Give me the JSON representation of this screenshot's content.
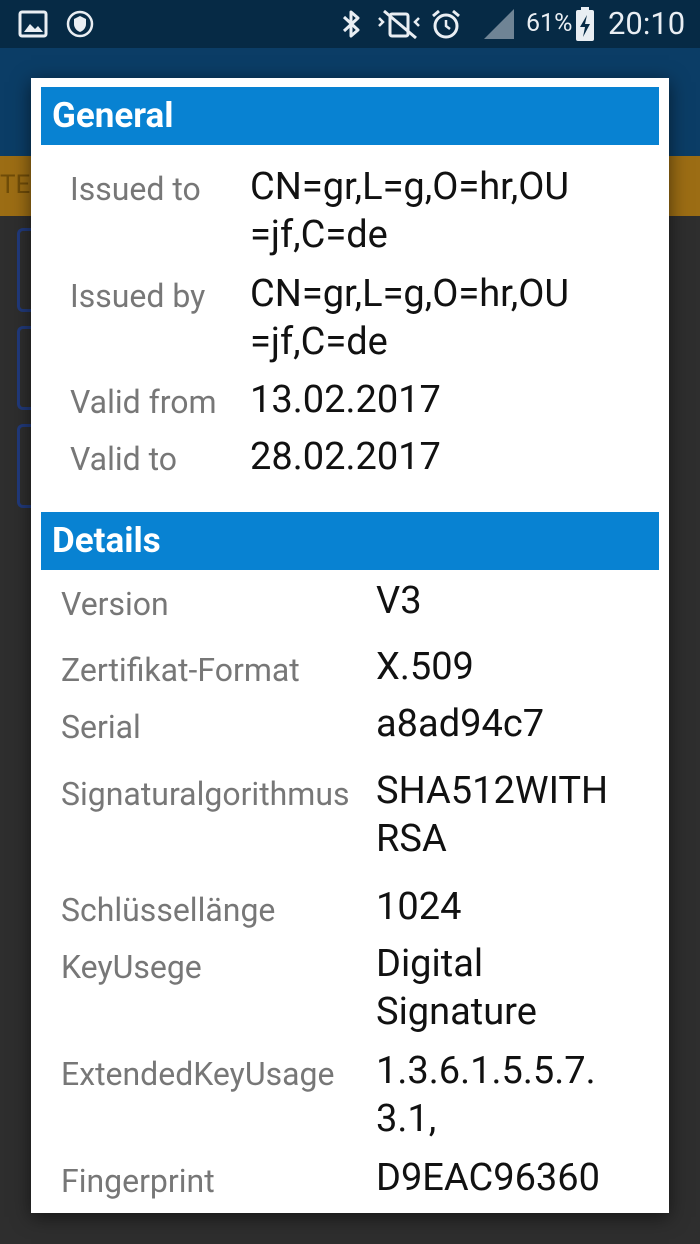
{
  "status_bar": {
    "battery_percent": "61%",
    "time": "20:10"
  },
  "background": {
    "strip_text": "TE"
  },
  "dialog": {
    "general": {
      "title": "General",
      "rows": [
        {
          "label": "Issued to",
          "value": "CN=gr,L=g,O=hr,OU\n=jf,C=de"
        },
        {
          "label": "Issued by",
          "value": "CN=gr,L=g,O=hr,OU\n=jf,C=de"
        },
        {
          "label": "Valid from",
          "value": "13.02.2017"
        },
        {
          "label": "Valid to",
          "value": "28.02.2017"
        }
      ]
    },
    "details": {
      "title": "Details",
      "rows": [
        {
          "label": "Version",
          "value": "V3"
        },
        {
          "label": "Zertifikat-Format",
          "value": "X.509"
        },
        {
          "label": "Serial",
          "value": "a8ad94c7"
        },
        {
          "label": "Signaturalgorithmus",
          "value": "SHA512WITH\nRSA"
        },
        {
          "label": "Schlüssellänge",
          "value": "1024"
        },
        {
          "label": "KeyUsege",
          "value": "Digital\nSignature"
        },
        {
          "label": "ExtendedKeyUsage",
          "value": "1.3.6.1.5.5.7.\n3.1,"
        },
        {
          "label": "Fingerprint",
          "value": "D9EAC96360"
        }
      ]
    }
  }
}
